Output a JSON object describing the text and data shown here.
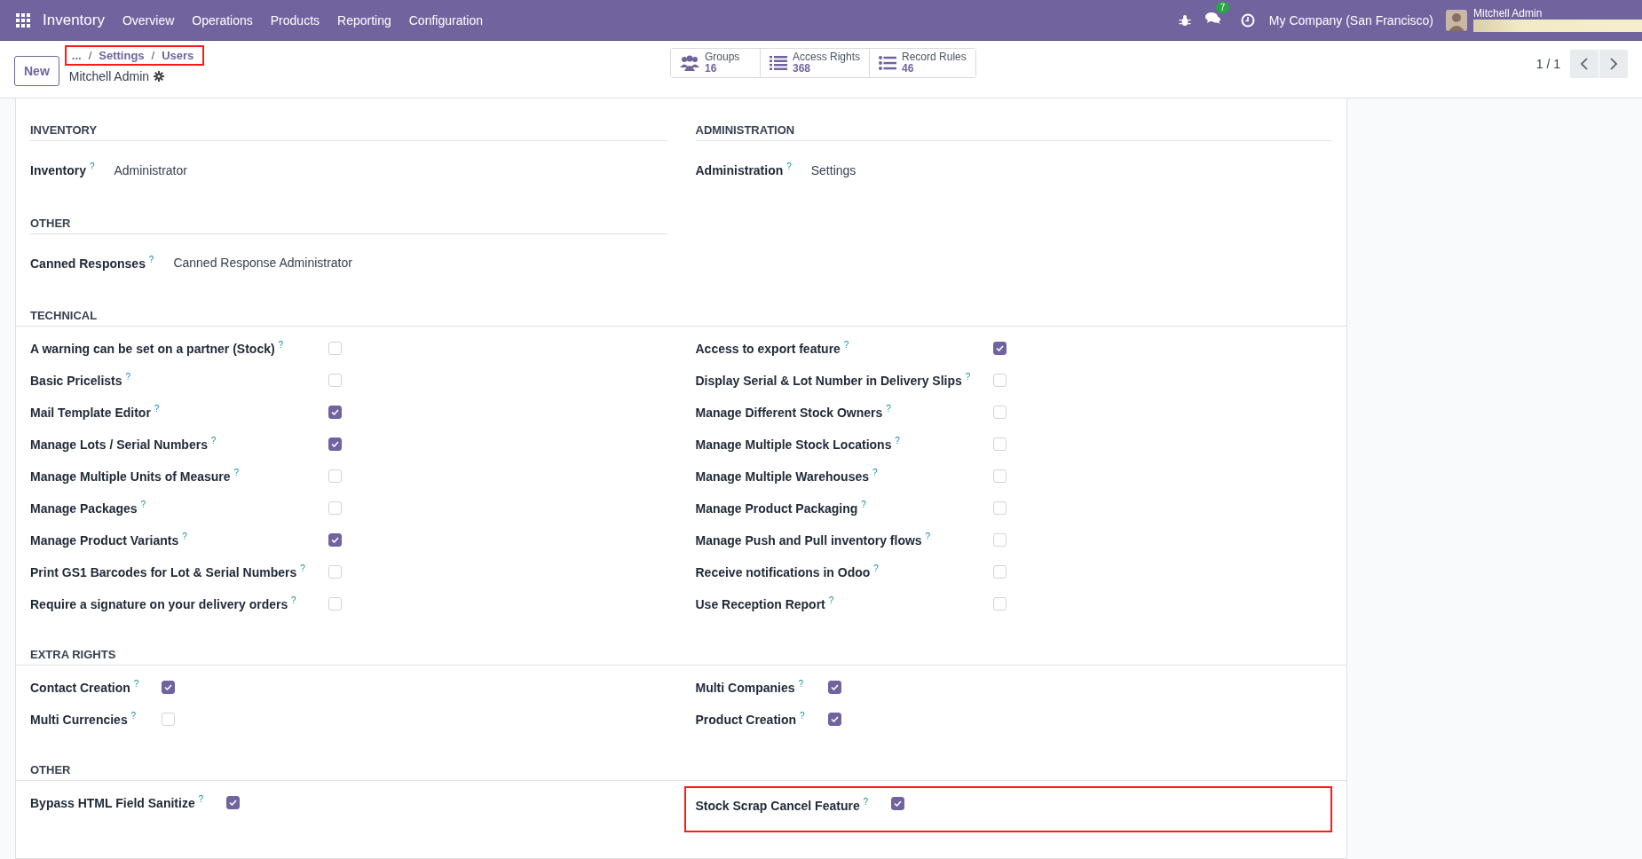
{
  "topbar": {
    "app_name": "Inventory",
    "menu": [
      "Overview",
      "Operations",
      "Products",
      "Reporting",
      "Configuration"
    ],
    "chat_count": "7",
    "company": "My Company (San Francisco)",
    "user": "Mitchell Admin"
  },
  "control_panel": {
    "new_button": "New",
    "breadcrumbs": {
      "highlighted": true,
      "separator": "/",
      "items": [
        "...",
        "Settings",
        "Users"
      ]
    },
    "record_name": "Mitchell Admin",
    "smart_buttons": [
      {
        "kind": "groups",
        "label": "Groups",
        "count": "16"
      },
      {
        "kind": "list",
        "label": "Access Rights",
        "count": "368"
      },
      {
        "kind": "rules",
        "label": "Record Rules",
        "count": "46"
      }
    ],
    "pager": "1 / 1"
  },
  "selection_groups": [
    {
      "title": "INVENTORY",
      "label": "Inventory $^{?}$",
      "value": "Administrator"
    },
    {
      "title": "ADMINISTRATION",
      "label": "Administration $^{?}$",
      "value": "Settings"
    },
    {
      "title": "OTHER",
      "label": "Canned Responses $^{?}$",
      "value": "Canned Response Administrator"
    }
  ],
  "checkbox_sections": [
    {
      "title": "TECHNICAL",
      "columns": [
        [
          {
            "label": "A warning can be set on a partner (Stock) $^{?}$",
            "checked": false
          },
          {
            "label": "Basic Pricelists $^{?}$",
            "checked": false
          },
          {
            "label": "Mail Template Editor $^{?}$",
            "checked": true
          },
          {
            "label": "Manage Lots / Serial Numbers $^{?}$",
            "checked": true
          },
          {
            "label": "Manage Multiple Units of Measure $^{?}$",
            "checked": false
          },
          {
            "label": "Manage Packages $^{?}$",
            "checked": false
          },
          {
            "label": "Manage Product Variants $^{?}$",
            "checked": true
          },
          {
            "label": "Print GS1 Barcodes for Lot & Serial Numbers $^{?}$",
            "checked": false
          },
          {
            "label": "Require a signature on your delivery orders $^{?}$",
            "checked": false
          }
        ],
        [
          {
            "label": "Access to export feature $^{?}$",
            "checked": true
          },
          {
            "label": "Display Serial & Lot Number in Delivery Slips $^{?}$",
            "checked": false
          },
          {
            "label": "Manage Different Stock Owners $^{?}$",
            "checked": false
          },
          {
            "label": "Manage Multiple Stock Locations $^{?}$",
            "checked": false
          },
          {
            "label": "Manage Multiple Warehouses $^{?}$",
            "checked": false
          },
          {
            "label": "Manage Product Packaging $^{?}$",
            "checked": false
          },
          {
            "label": "Manage Push and Pull inventory flows $^{?}$",
            "checked": false
          },
          {
            "label": "Receive notifications in Odoo $^{?}$",
            "checked": false
          },
          {
            "label": "Use Reception Report $^{?}$",
            "checked": false
          }
        ]
      ]
    },
    {
      "title": "EXTRA RIGHTS",
      "columns": [
        [
          {
            "label": "Contact Creation $^{?}$",
            "checked": true
          },
          {
            "label": "Multi Currencies $^{?}$",
            "checked": false
          }
        ],
        [
          {
            "label": "Multi Companies $^{?}$",
            "checked": true
          },
          {
            "label": "Product Creation $^{?}$",
            "checked": true
          }
        ]
      ]
    },
    {
      "title": "OTHER",
      "columns": [
        [
          {
            "label": "Bypass HTML Field Sanitize $^{?}$",
            "checked": true
          }
        ],
        [
          {
            "label": "Stock Scrap Cancel Feature $^{?}$",
            "checked": true,
            "highlighted": true
          }
        ]
      ]
    }
  ]
}
